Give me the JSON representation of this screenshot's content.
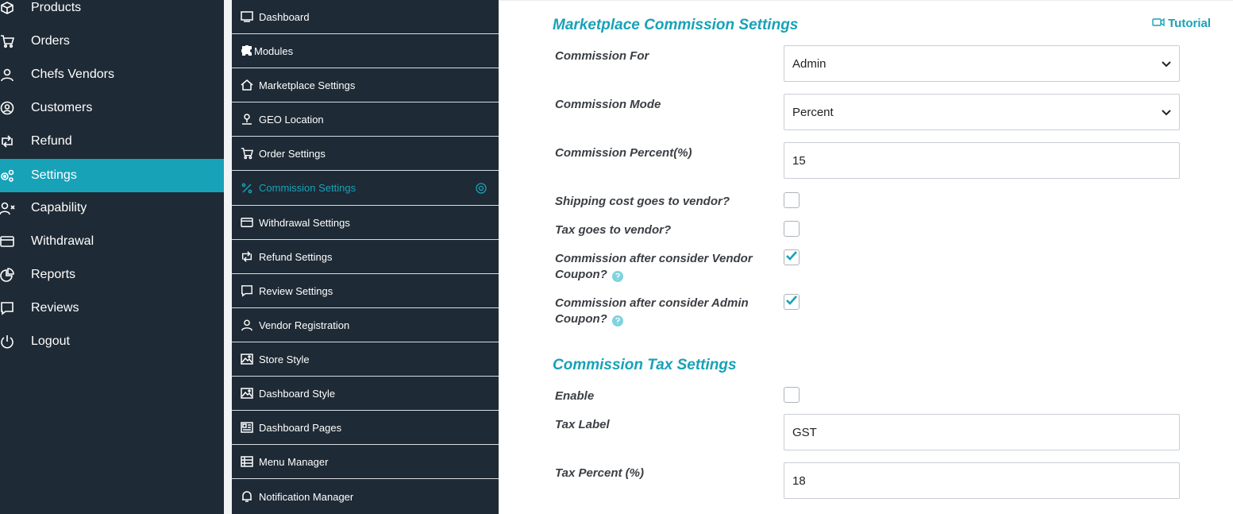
{
  "main_nav": {
    "items": [
      {
        "label": "Products",
        "icon": "cube-icon",
        "active": false
      },
      {
        "label": "Orders",
        "icon": "cart-icon",
        "active": false
      },
      {
        "label": "Chefs Vendors",
        "icon": "user-icon",
        "active": false
      },
      {
        "label": "Customers",
        "icon": "user-circle-icon",
        "active": false
      },
      {
        "label": "Refund",
        "icon": "retweet-icon",
        "active": false
      },
      {
        "label": "Settings",
        "icon": "cogs-icon",
        "active": true
      },
      {
        "label": "Capability",
        "icon": "user-times-icon",
        "active": false
      },
      {
        "label": "Withdrawal",
        "icon": "credit-card-icon",
        "active": false
      },
      {
        "label": "Reports",
        "icon": "pie-chart-icon",
        "active": false
      },
      {
        "label": "Reviews",
        "icon": "comment-icon",
        "active": false
      },
      {
        "label": "Logout",
        "icon": "power-icon",
        "active": false
      }
    ]
  },
  "settings_menu": {
    "items": [
      {
        "label": "Dashboard",
        "icon": "monitor-icon",
        "active": false
      },
      {
        "label": "Modules",
        "icon": "puzzle-icon",
        "active": false
      },
      {
        "label": "Marketplace Settings",
        "icon": "home-icon",
        "active": false
      },
      {
        "label": "GEO Location",
        "icon": "location-pin-icon",
        "active": false
      },
      {
        "label": "Order Settings",
        "icon": "cart-icon",
        "active": false
      },
      {
        "label": "Commission Settings",
        "icon": "percent-icon",
        "active": true
      },
      {
        "label": "Withdrawal Settings",
        "icon": "credit-card-icon",
        "active": false
      },
      {
        "label": "Refund Settings",
        "icon": "retweet-icon",
        "active": false
      },
      {
        "label": "Review Settings",
        "icon": "comment-icon",
        "active": false
      },
      {
        "label": "Vendor Registration",
        "icon": "user-icon",
        "active": false
      },
      {
        "label": "Store Style",
        "icon": "image-icon",
        "active": false
      },
      {
        "label": "Dashboard Style",
        "icon": "image-icon",
        "active": false
      },
      {
        "label": "Dashboard Pages",
        "icon": "newspaper-icon",
        "active": false
      },
      {
        "label": "Menu Manager",
        "icon": "list-icon",
        "active": false
      },
      {
        "label": "Notification Manager",
        "icon": "bell-icon",
        "active": false
      }
    ]
  },
  "content": {
    "tutorial_label": "Tutorial",
    "commission_section": {
      "title": "Marketplace Commission Settings",
      "commission_for": {
        "label": "Commission For",
        "value": "Admin"
      },
      "commission_mode": {
        "label": "Commission Mode",
        "value": "Percent"
      },
      "commission_percent": {
        "label": "Commission Percent(%)",
        "value": "15"
      },
      "shipping_to_vendor": {
        "label": "Shipping cost goes to vendor?",
        "checked": false
      },
      "tax_to_vendor": {
        "label": "Tax goes to vendor?",
        "checked": false
      },
      "vendor_coupon": {
        "label": "Commission after consider Vendor Coupon?",
        "checked": true
      },
      "admin_coupon": {
        "label": "Commission after consider Admin Coupon?",
        "checked": true
      }
    },
    "tax_section": {
      "title": "Commission Tax Settings",
      "enable": {
        "label": "Enable",
        "checked": false
      },
      "tax_label": {
        "label": "Tax Label",
        "value": "GST"
      },
      "tax_percent": {
        "label": "Tax Percent (%)",
        "value": "18"
      }
    }
  },
  "colors": {
    "sidebar_bg": "#1e2a35",
    "accent": "#17a2b8",
    "label_text": "#3b3f44"
  }
}
